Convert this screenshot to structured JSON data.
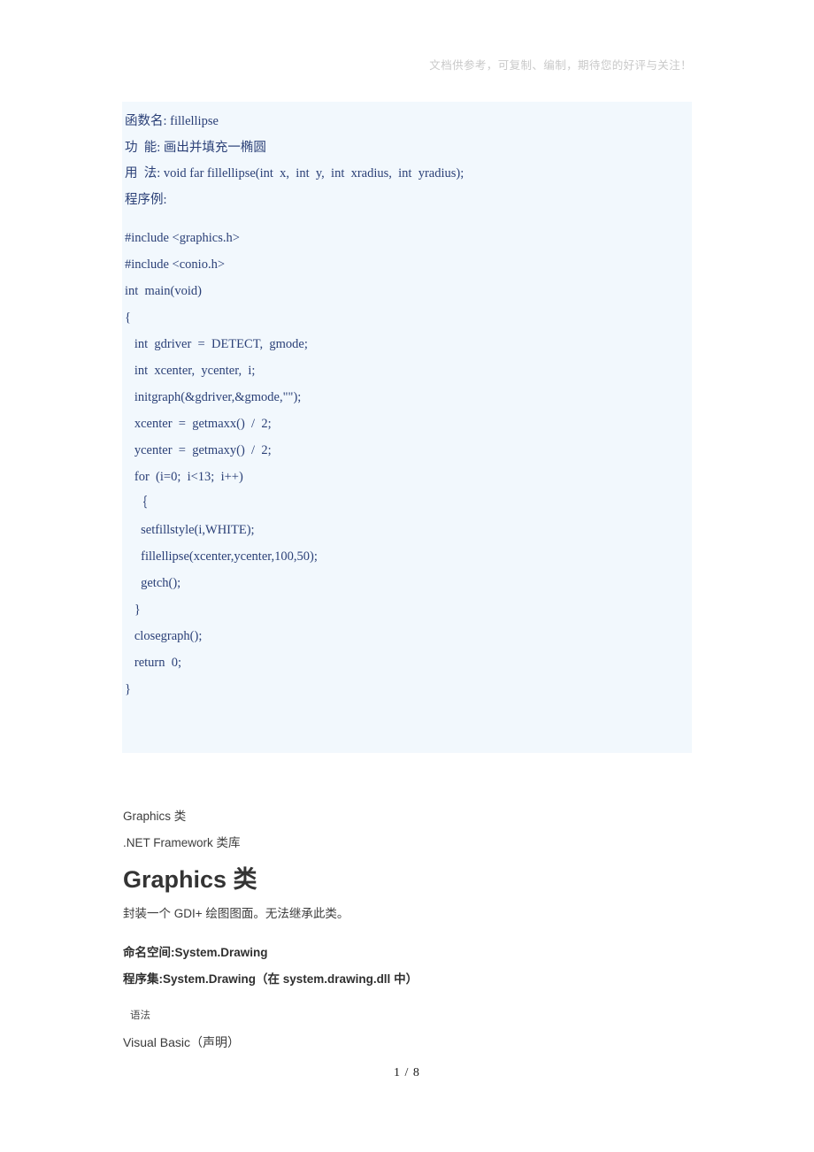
{
  "document": {
    "header_note": "文档供参考，可复制、编制，期待您的好评与关注！",
    "footer": "1 / 8",
    "page_number": "1",
    "page_total": "8"
  },
  "reference_block": {
    "background_color": "#f2f8fd",
    "text_color": "#2b4077",
    "spec": [
      "函数名: fillellipse",
      "功  能: 画出并填充一椭圆",
      "用  法: void far fillellipse(int  x,  int  y,  int  xradius,  int  yradius);",
      "程序例:"
    ],
    "code": [
      "#include <graphics.h>",
      "#include <conio.h>",
      "",
      "int  main(void)",
      "{",
      "   int  gdriver  =  DETECT,  gmode;",
      "   int  xcenter,  ycenter,  i;",
      "",
      "   initgraph(&gdriver,&gmode,\"\");",
      "   xcenter  =  getmaxx()  /  2;",
      "   ycenter  =  getmaxy()  /  2;",
      "",
      "   for  (i=0;  i<13;  i++)",
      "   ｛",
      "     setfillstyle(i,WHITE);",
      "     fillellipse(xcenter,ycenter,100,50);",
      "     getch();",
      "   }",
      "",
      "   closegraph();",
      "   return  0;",
      "}"
    ]
  },
  "article": {
    "breadcrumb_class": "Graphics 类",
    "breadcrumb_framework": ".NET Framework 类库",
    "heading": "Graphics 类",
    "description": "封装一个 GDI+ 绘图图面。无法继承此类。",
    "namespace_line": "命名空间:System.Drawing",
    "assembly_line": "程序集:System.Drawing（在 system.drawing.dll 中）",
    "syntax_label": "语法",
    "language_line": "Visual Basic（声明）"
  }
}
